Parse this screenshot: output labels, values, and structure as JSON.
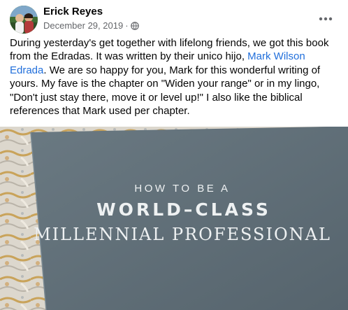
{
  "post": {
    "author": "Erick Reyes",
    "date": "December 29, 2019",
    "separator": "·",
    "privacy_icon": "globe-icon",
    "more_icon": "more-options-icon",
    "text_part1": "During yesterday's get together with lifelong friends, we got this book from the Edradas. It was written by their unico hijo, ",
    "mention": "Mark Wilson Edrada",
    "text_part2": ". We are so happy for you, Mark for this wonderful writing of yours. My fave is the chapter on \"Widen your range\" or in my lingo, \"Don't just stay there, move it or level up!\" I also like the biblical references that Mark used per chapter."
  },
  "photo": {
    "book_line1": "HOW TO BE A",
    "book_line2": "WORLD–CLASS",
    "book_line3": "MILLENNIAL PROFESSIONAL"
  },
  "colors": {
    "link": "#216fdb",
    "meta_text": "#65676b",
    "book_cover": "#5e6d76",
    "blanket": "#d8d3c8"
  }
}
